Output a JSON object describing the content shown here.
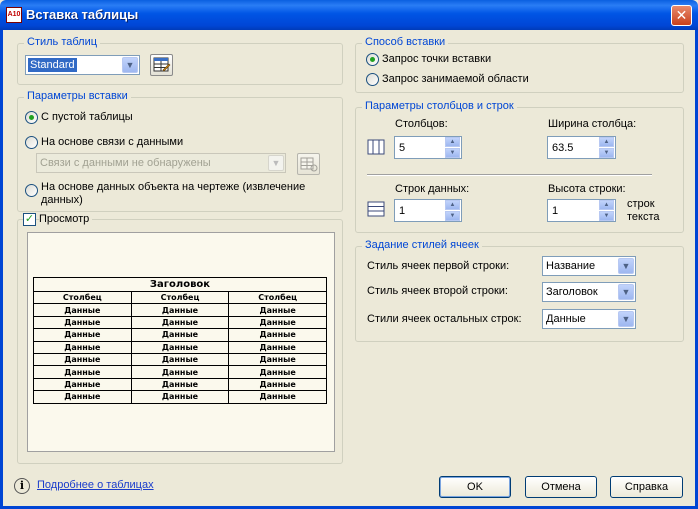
{
  "window": {
    "title": "Вставка таблицы",
    "app_icon_text": "A10"
  },
  "table_style": {
    "group_label": "Стиль таблиц",
    "selected": "Standard"
  },
  "insert_params": {
    "group_label": "Параметры вставки",
    "options": [
      "С пустой таблицы",
      "На основе связи с данными",
      "На основе данных объекта на чертеже (извлечение данных)"
    ],
    "data_link_placeholder": "Связи с данными не обнаружены"
  },
  "preview": {
    "label": "Просмотр",
    "table": {
      "title": "Заголовок",
      "headers": [
        "Столбец",
        "Столбец",
        "Столбец"
      ],
      "rows": [
        [
          "Данные",
          "Данные",
          "Данные"
        ],
        [
          "Данные",
          "Данные",
          "Данные"
        ],
        [
          "Данные",
          "Данные",
          "Данные"
        ],
        [
          "Данные",
          "Данные",
          "Данные"
        ],
        [
          "Данные",
          "Данные",
          "Данные"
        ],
        [
          "Данные",
          "Данные",
          "Данные"
        ],
        [
          "Данные",
          "Данные",
          "Данные"
        ],
        [
          "Данные",
          "Данные",
          "Данные"
        ]
      ]
    }
  },
  "insert_method": {
    "group_label": "Способ вставки",
    "options": [
      "Запрос точки вставки",
      "Запрос занимаемой области"
    ]
  },
  "col_row_params": {
    "group_label": "Параметры столбцов и строк",
    "columns_label": "Столбцов:",
    "columns_value": "5",
    "col_width_label": "Ширина столбца:",
    "col_width_value": "63.5",
    "data_rows_label": "Строк данных:",
    "data_rows_value": "1",
    "row_height_label": "Высота строки:",
    "row_height_value": "1",
    "row_height_unit": "строк текста"
  },
  "cell_styles": {
    "group_label": "Задание стилей ячеек",
    "first_row_label": "Стиль ячеек первой строки:",
    "first_row_value": "Название",
    "second_row_label": "Стиль ячеек второй строки:",
    "second_row_value": "Заголовок",
    "other_rows_label": "Стили ячеек остальных строк:",
    "other_rows_value": "Данные"
  },
  "footer": {
    "help_link": "Подробнее о таблицах",
    "ok": "OK",
    "cancel": "Отмена",
    "help": "Справка"
  }
}
